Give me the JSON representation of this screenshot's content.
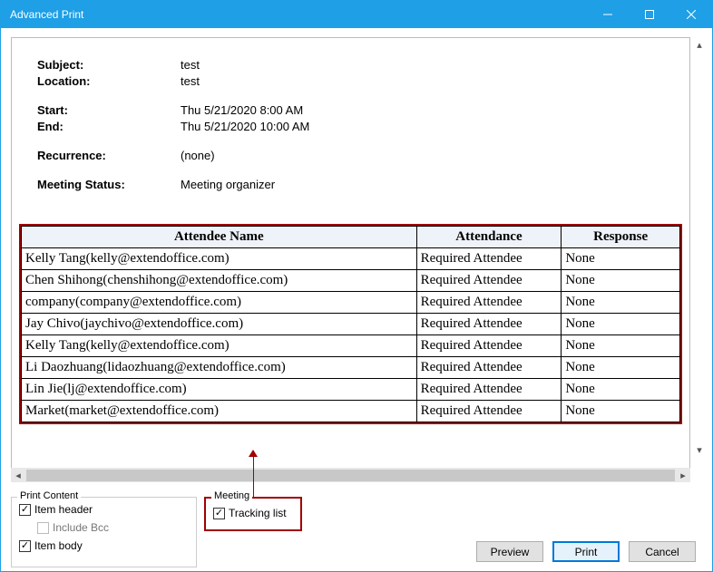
{
  "window": {
    "title": "Advanced Print"
  },
  "header": {
    "subject_label": "Subject:",
    "subject_value": "test",
    "location_label": "Location:",
    "location_value": "test",
    "start_label": "Start:",
    "start_value": "Thu 5/21/2020 8:00 AM",
    "end_label": "End:",
    "end_value": "Thu 5/21/2020 10:00 AM",
    "recurrence_label": "Recurrence:",
    "recurrence_value": "(none)",
    "status_label": "Meeting Status:",
    "status_value": "Meeting organizer"
  },
  "table": {
    "columns": {
      "name": "Attendee Name",
      "attendance": "Attendance",
      "response": "Response"
    },
    "rows": [
      {
        "name": "Kelly Tang(kelly@extendoffice.com)",
        "attendance": "Required Attendee",
        "response": "None"
      },
      {
        "name": "Chen Shihong(chenshihong@extendoffice.com)",
        "attendance": "Required Attendee",
        "response": "None"
      },
      {
        "name": "company(company@extendoffice.com)",
        "attendance": "Required Attendee",
        "response": "None"
      },
      {
        "name": "Jay Chivo(jaychivo@extendoffice.com)",
        "attendance": "Required Attendee",
        "response": "None"
      },
      {
        "name": "Kelly Tang(kelly@extendoffice.com)",
        "attendance": "Required Attendee",
        "response": "None"
      },
      {
        "name": "Li Daozhuang(lidaozhuang@extendoffice.com)",
        "attendance": "Required Attendee",
        "response": "None"
      },
      {
        "name": "Lin Jie(lj@extendoffice.com)",
        "attendance": "Required Attendee",
        "response": "None"
      },
      {
        "name": "Market(market@extendoffice.com)",
        "attendance": "Required Attendee",
        "response": "None"
      }
    ]
  },
  "print_content": {
    "legend": "Print Content",
    "item_header": "Item header",
    "include_bcc": "Include Bcc",
    "item_body": "Item body"
  },
  "meeting_group": {
    "legend": "Meeting",
    "tracking_list": "Tracking list"
  },
  "buttons": {
    "preview": "Preview",
    "print": "Print",
    "cancel": "Cancel"
  }
}
